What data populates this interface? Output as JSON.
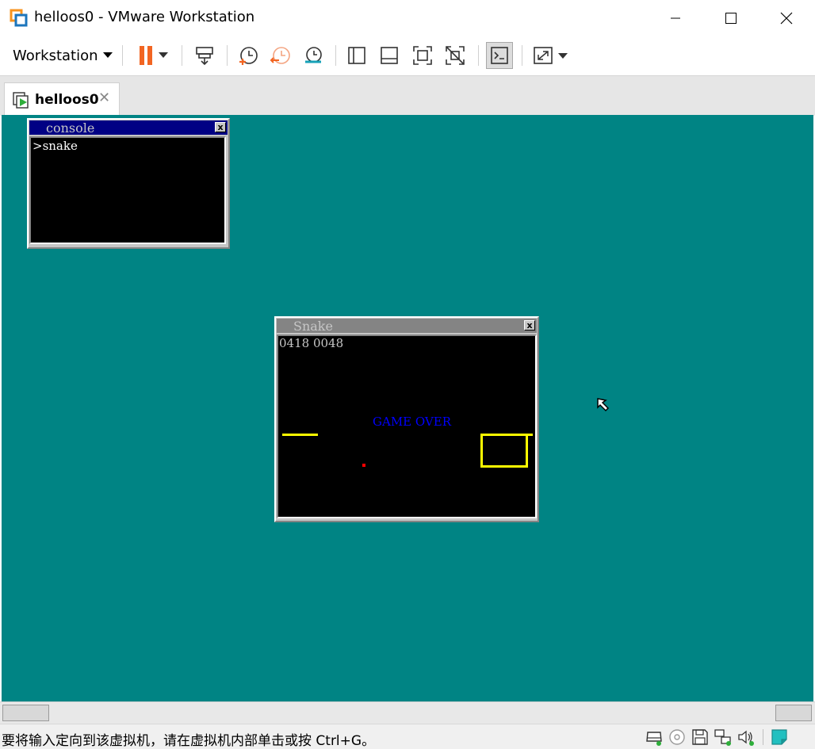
{
  "window": {
    "title": "helloos0 - VMware Workstation"
  },
  "toolbar": {
    "menu_label": "Workstation",
    "icons": [
      "pause-icon",
      "send-ctrl-alt-del-icon",
      "snapshot-take-icon",
      "snapshot-revert-icon",
      "snapshot-manager-icon",
      "library-view-icon",
      "thumbnail-bar-icon",
      "fullscreen-icon",
      "unity-icon",
      "console-view-icon",
      "stretch-guest-icon"
    ]
  },
  "tab": {
    "label": "helloos0",
    "close_glyph": "✕"
  },
  "guest": {
    "console_window": {
      "title": "console",
      "close_glyph": "x",
      "prompt_text": ">snake"
    },
    "snake_window": {
      "title": "Snake",
      "close_glyph": "x",
      "score_text": "0418 0048",
      "game_over_text": "GAME OVER"
    }
  },
  "status": {
    "message": "要将输入定向到该虚拟机，请在虚拟机内部单击或按 Ctrl+G。",
    "device_icons": [
      "hard-disk-icon",
      "cd-rom-icon",
      "floppy-icon",
      "network-icon",
      "sound-icon",
      "message-log-icon"
    ]
  },
  "colors": {
    "guest_background": "#008484",
    "console_titlebar_active": "#000084",
    "snake_titlebar_inactive": "#848484",
    "snake_body": "#ffff00",
    "food": "#ff0000",
    "game_over_text": "#0000ff",
    "pause_orange": "#f26522"
  }
}
